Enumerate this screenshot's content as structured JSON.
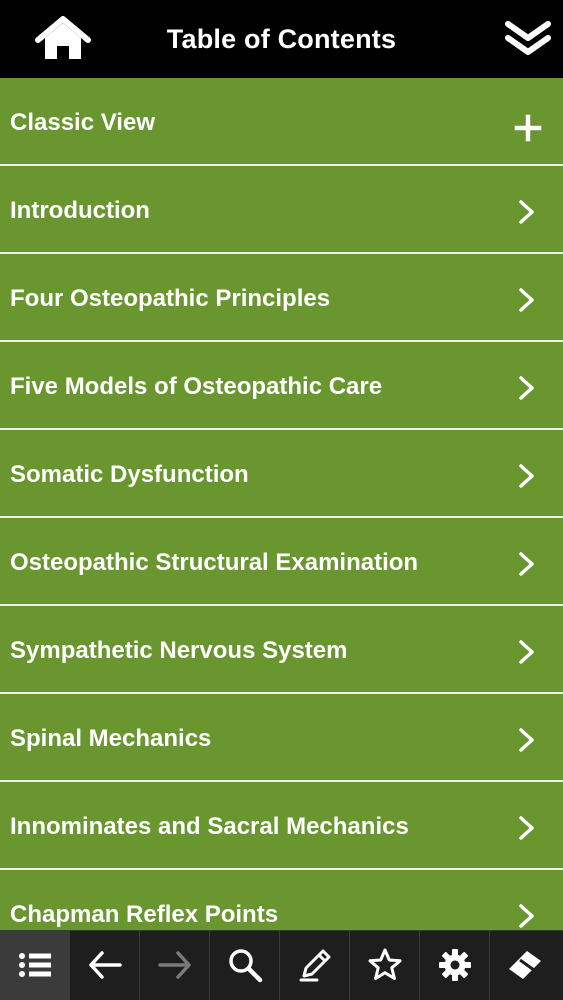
{
  "header": {
    "title": "Table of Contents",
    "home_icon": "home-icon",
    "collapse_icon": "double-chevron-down-icon"
  },
  "toc": {
    "items": [
      {
        "label": "Classic View",
        "icon": "plus-icon"
      },
      {
        "label": "Introduction",
        "icon": "chevron-right-icon"
      },
      {
        "label": "Four Osteopathic Principles",
        "icon": "chevron-right-icon"
      },
      {
        "label": "Five Models of Osteopathic Care",
        "icon": "chevron-right-icon"
      },
      {
        "label": "Somatic Dysfunction",
        "icon": "chevron-right-icon"
      },
      {
        "label": "Osteopathic Structural Examination",
        "icon": "chevron-right-icon"
      },
      {
        "label": "Sympathetic Nervous System",
        "icon": "chevron-right-icon"
      },
      {
        "label": "Spinal Mechanics",
        "icon": "chevron-right-icon"
      },
      {
        "label": "Innominates and Sacral Mechanics",
        "icon": "chevron-right-icon"
      },
      {
        "label": "Chapman Reflex Points",
        "icon": "chevron-right-icon"
      }
    ]
  },
  "toolbar": {
    "buttons": [
      {
        "icon": "list-icon",
        "state": "selected"
      },
      {
        "icon": "back-arrow-icon",
        "state": "enabled"
      },
      {
        "icon": "forward-arrow-icon",
        "state": "disabled"
      },
      {
        "icon": "search-icon",
        "state": "enabled"
      },
      {
        "icon": "pencil-icon",
        "state": "enabled"
      },
      {
        "icon": "star-icon",
        "state": "enabled"
      },
      {
        "icon": "gear-icon",
        "state": "enabled"
      },
      {
        "icon": "eraser-icon",
        "state": "enabled"
      }
    ]
  },
  "colors": {
    "header_bg": "#000000",
    "row_bg": "#6a962f",
    "row_separator": "#eef2e8",
    "text": "#ffffff",
    "toolbar_bg": "#1e1e1e",
    "toolbar_selected": "#3b3b3b",
    "icon_disabled": "#7a7a7a"
  }
}
